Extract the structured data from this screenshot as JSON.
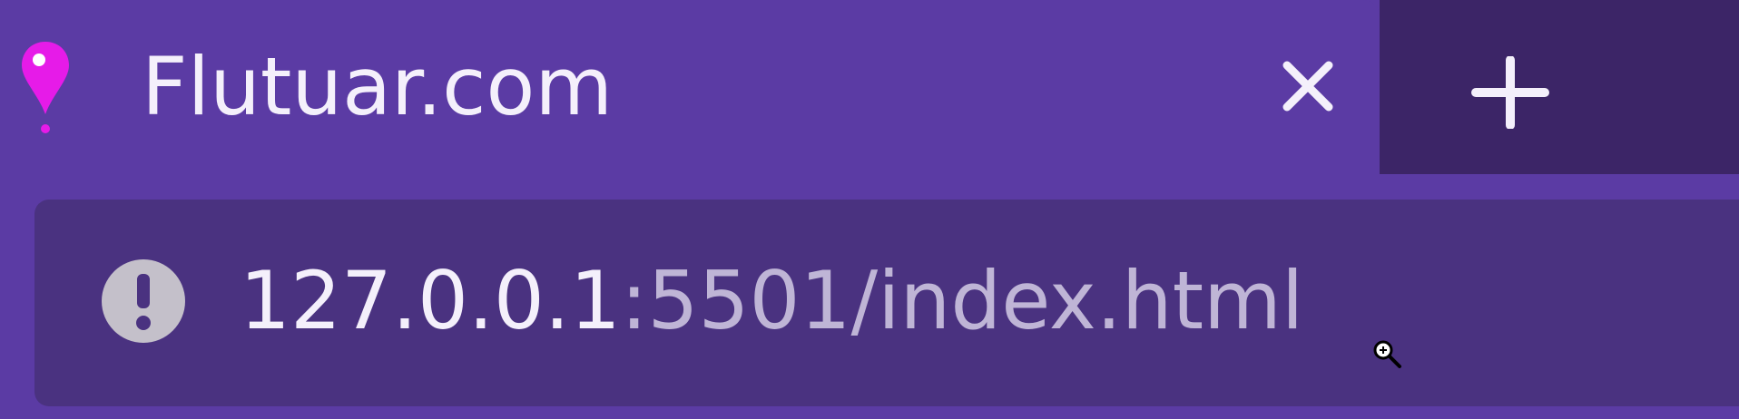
{
  "tab": {
    "title": "Flutuar.com",
    "favicon": "map-pin-icon",
    "close_icon": "close-icon"
  },
  "new_tab": {
    "icon": "plus-icon"
  },
  "address_bar": {
    "security_icon": "warning-icon",
    "url_host": "127.0.0.1",
    "url_rest": ":5501/index.html"
  },
  "cursor": {
    "icon": "zoom-in-cursor-icon"
  },
  "colors": {
    "tab_bg": "#5b3ba4",
    "tabstrip_rest": "#3c2567",
    "urlbar_bg": "#4a3280",
    "favicon": "#e61be8",
    "text_primary": "#f4f0fb",
    "text_secondary": "#bfb5d6"
  }
}
